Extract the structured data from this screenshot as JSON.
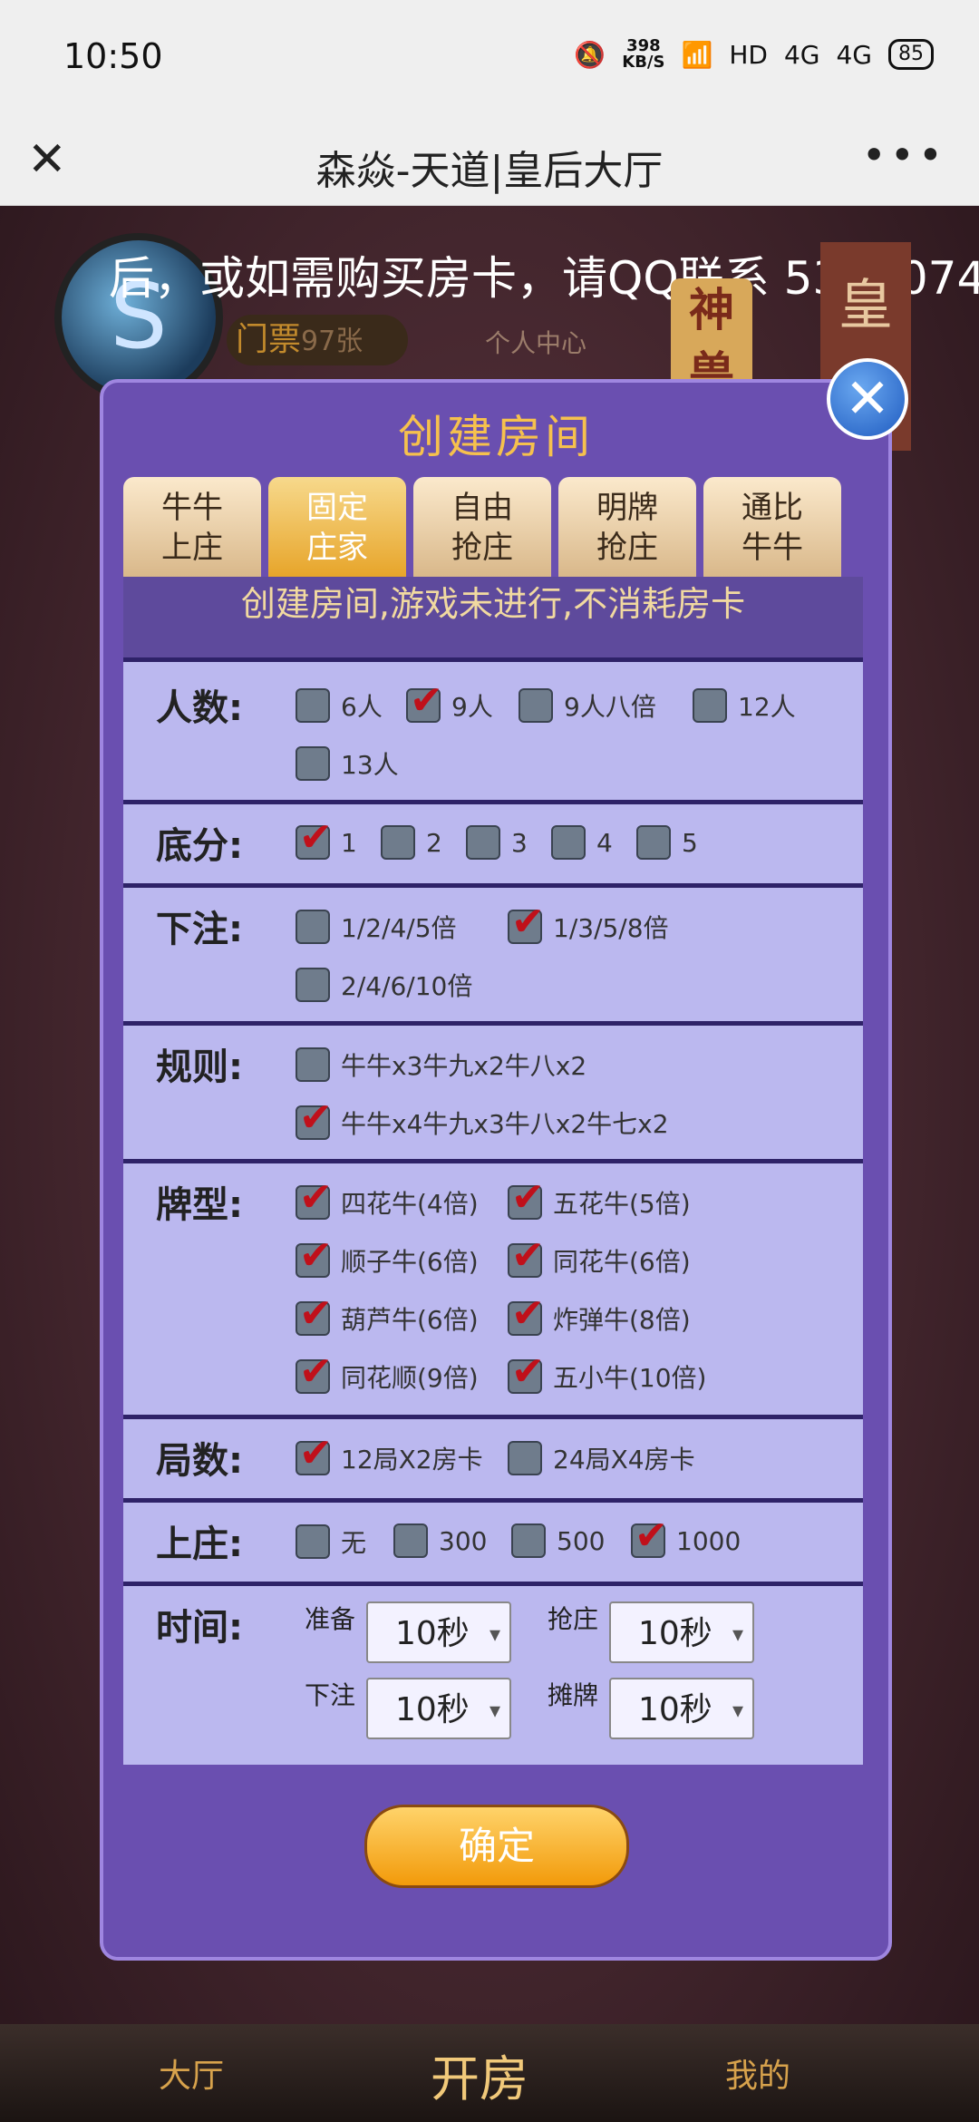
{
  "status": {
    "time": "10:50",
    "speed_top": "398",
    "speed_bottom": "KB/S",
    "network1": "HD",
    "network2": "4G",
    "network3": "4G",
    "battery": "85"
  },
  "titlebar": {
    "close_glyph": "✕",
    "title": "森焱-天道|皇后大厅",
    "more_glyph": "•••"
  },
  "background": {
    "marquee": "后，或如需购买房卡，请QQ联系 5372074",
    "ticket_label": "门票",
    "ticket_count": "97张",
    "center_text": "个人中心",
    "beast_text": "神兽",
    "queen_text": "皇"
  },
  "dialog": {
    "close_glyph": "✕",
    "title": "创建房间",
    "tabs": [
      {
        "line1": "牛牛",
        "line2": "上庄",
        "active": false
      },
      {
        "line1": "固定",
        "line2": "庄家",
        "active": true
      },
      {
        "line1": "自由",
        "line2": "抢庄",
        "active": false
      },
      {
        "line1": "明牌",
        "line2": "抢庄",
        "active": false
      },
      {
        "line1": "通比",
        "line2": "牛牛",
        "active": false
      }
    ],
    "notice": "创建房间,游戏未进行,不消耗房卡",
    "sections": {
      "players": {
        "label": "人数:",
        "options": [
          {
            "t": "6人",
            "on": false
          },
          {
            "t": "9人",
            "on": true
          },
          {
            "t": "9人八倍",
            "on": false
          },
          {
            "t": "12人",
            "on": false
          },
          {
            "t": "13人",
            "on": false
          }
        ]
      },
      "base": {
        "label": "底分:",
        "options": [
          {
            "t": "1",
            "on": true
          },
          {
            "t": "2",
            "on": false
          },
          {
            "t": "3",
            "on": false
          },
          {
            "t": "4",
            "on": false
          },
          {
            "t": "5",
            "on": false
          }
        ]
      },
      "bet": {
        "label": "下注:",
        "options": [
          {
            "t": "1/2/4/5倍",
            "on": false
          },
          {
            "t": "1/3/5/8倍",
            "on": true
          },
          {
            "t": "2/4/6/10倍",
            "on": false
          }
        ]
      },
      "rules": {
        "label": "规则:",
        "options": [
          {
            "t": "牛牛x3牛九x2牛八x2",
            "on": false
          },
          {
            "t": "牛牛x4牛九x3牛八x2牛七x2",
            "on": true
          }
        ]
      },
      "cards": {
        "label": "牌型:",
        "options": [
          {
            "t": "四花牛(4倍)",
            "on": true
          },
          {
            "t": "五花牛(5倍)",
            "on": true
          },
          {
            "t": "顺子牛(6倍)",
            "on": true
          },
          {
            "t": "同花牛(6倍)",
            "on": true
          },
          {
            "t": "葫芦牛(6倍)",
            "on": true
          },
          {
            "t": "炸弹牛(8倍)",
            "on": true
          },
          {
            "t": "同花顺(9倍)",
            "on": true
          },
          {
            "t": "五小牛(10倍)",
            "on": true
          }
        ]
      },
      "rounds": {
        "label": "局数:",
        "options": [
          {
            "t": "12局X2房卡",
            "on": true
          },
          {
            "t": "24局X4房卡",
            "on": false
          }
        ]
      },
      "banker": {
        "label": "上庄:",
        "options": [
          {
            "t": "无",
            "on": false
          },
          {
            "t": "300",
            "on": false
          },
          {
            "t": "500",
            "on": false
          },
          {
            "t": "1000",
            "on": true
          }
        ]
      },
      "time": {
        "label": "时间:",
        "ready_label": "准备",
        "ready_value": "10秒",
        "grab_label": "抢庄",
        "grab_value": "10秒",
        "bet_label": "下注",
        "bet_value": "10秒",
        "show_label": "摊牌",
        "show_value": "10秒"
      }
    },
    "confirm": "确定"
  },
  "nav": {
    "hall": "大厅",
    "open_room": "开房",
    "mine": "我的"
  }
}
